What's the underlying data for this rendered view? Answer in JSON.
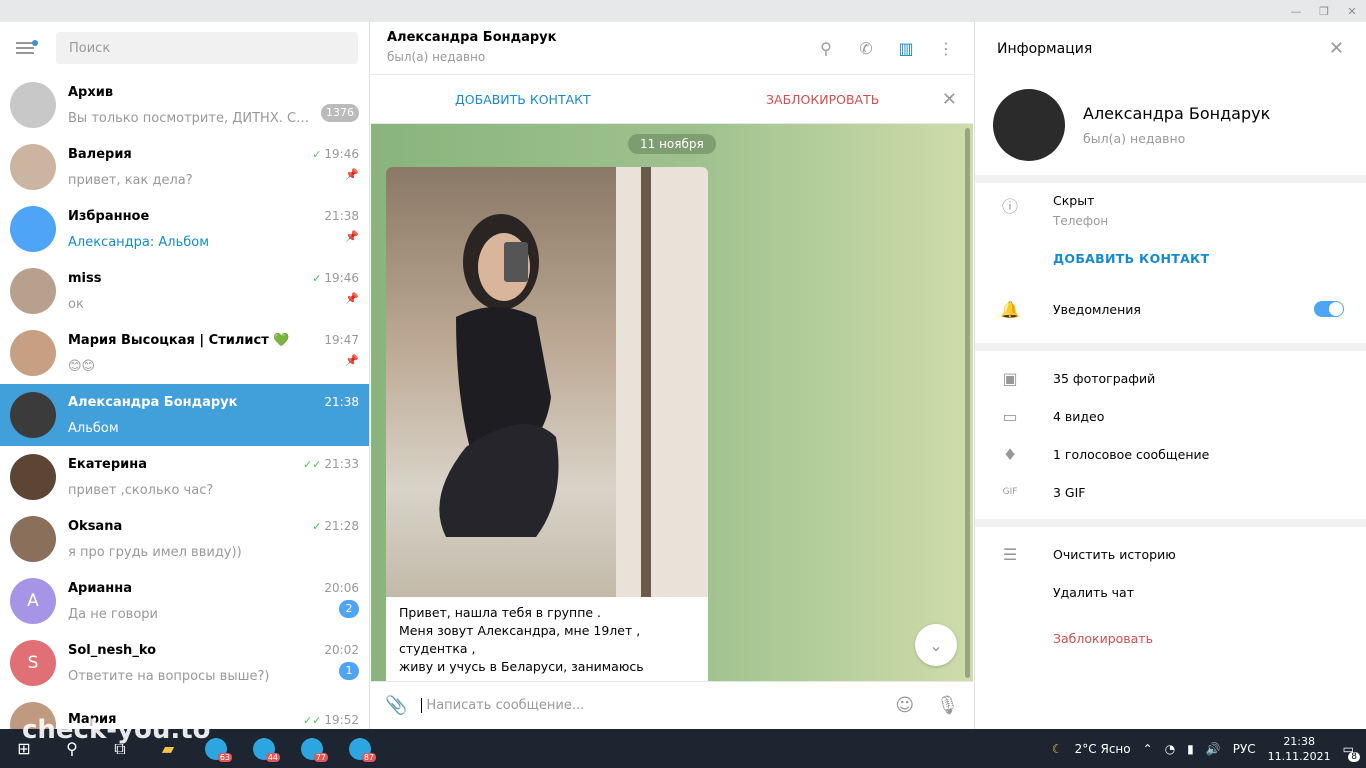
{
  "sidebar": {
    "search_placeholder": "Поиск",
    "chats": [
      {
        "name": "Архив",
        "time": "",
        "msg": "Вы только посмотрите, ДИТНХ. СОДЕ...",
        "badge": "1376",
        "badge_muted": true,
        "avatar_color": "#c8c8c8"
      },
      {
        "name": "Валерия",
        "time": "19:46",
        "msg": "привет, как дела?",
        "check": "✓",
        "pinned": true,
        "avatar_color": "#cbb4a0"
      },
      {
        "name": "Избранное",
        "time": "21:38",
        "msg_prefix": "Александра:",
        "msg": "Альбом",
        "pinned": true,
        "avatar_color": "#4ea4f6"
      },
      {
        "name": "miss",
        "time": "19:46",
        "msg": "ок",
        "check": "✓",
        "pinned": true,
        "avatar_color": "#b8a08f"
      },
      {
        "name": "Мария Высоцкая | Стилист 💚",
        "time": "19:47",
        "msg": "😊😊",
        "pinned": true,
        "avatar_color": "#c7a083"
      },
      {
        "name": "Александра Бондарук",
        "time": "21:38",
        "msg": "Альбом",
        "active": true,
        "avatar_color": "#3b3b3b"
      },
      {
        "name": "Екатерина",
        "time": "21:33",
        "msg": "привет ,сколько час?",
        "check": "✓✓",
        "avatar_color": "#5c4535"
      },
      {
        "name": "Oksana",
        "time": "21:28",
        "msg": "я про грудь имел ввиду))",
        "check": "✓",
        "avatar_color": "#8a6f5a"
      },
      {
        "name": "Арианна",
        "time": "20:06",
        "msg": "Да не говори",
        "badge": "2",
        "avatar_letter": "А",
        "avatar_color": "#a695e7"
      },
      {
        "name": "Sol_nesh_ko",
        "time": "20:02",
        "msg": "Ответите на вопросы выше?)",
        "badge": "1",
        "avatar_letter": "S",
        "avatar_color": "#e17076"
      },
      {
        "name": "Мария",
        "time": "19:52",
        "msg": "",
        "check": "✓✓",
        "avatar_color": "#c09a80"
      }
    ]
  },
  "chat": {
    "title": "Александра Бондарук",
    "status": "был(а) недавно",
    "add_contact": "ДОБАВИТЬ КОНТАКТ",
    "block": "ЗАБЛОКИРОВАТЬ",
    "date_badge": "11 ноября",
    "message_text": "Привет, нашла тебя в группе .\nМеня зовут Александра, мне 19лет , студентка ,\nживу и учусь в Беларуси, занимаюсь\nспортом,не имею вредных привычек , люблю\nхорошее общение )",
    "compose_placeholder": "Написать сообщение..."
  },
  "info": {
    "title": "Информация",
    "name": "Александра Бондарук",
    "status": "был(а) недавно",
    "phone_value": "Скрыт",
    "phone_label": "Телефон",
    "add_contact": "ДОБАВИТЬ КОНТАКТ",
    "notifications": "Уведомления",
    "notifications_on": true,
    "photos": "35 фотографий",
    "videos": "4 видео",
    "voice": "1 голосовое сообщение",
    "gifs": "3 GIF",
    "clear_history": "Очистить историю",
    "delete_chat": "Удалить чат",
    "block": "Заблокировать"
  },
  "taskbar": {
    "weather": "2°C  Ясно",
    "lang": "РУС",
    "time": "21:38",
    "date": "11.11.2021",
    "notif": "8",
    "tg_badges": [
      "63",
      "44",
      "77",
      "87"
    ]
  },
  "watermark": "check-you.to"
}
